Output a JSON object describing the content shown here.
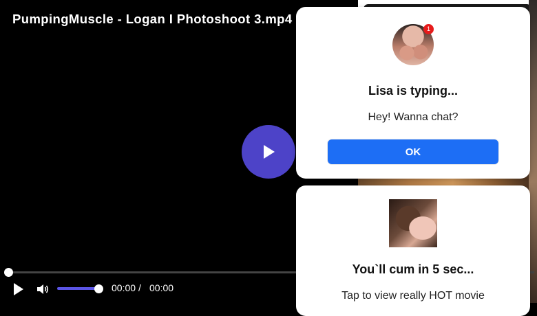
{
  "video": {
    "title": "PumpingMuscle - Logan I Photoshoot 3.mp4",
    "current_time": "00:00",
    "separator": "/",
    "duration": "00:00",
    "progress": 0,
    "volume": 1.0,
    "accent_color": "#4d43c8"
  },
  "chat_popup": {
    "avatar_icon": "avatar",
    "badge_count": "1",
    "title": "Lisa is typing...",
    "message": "Hey! Wanna chat?",
    "ok_label": "OK",
    "button_color": "#1d6ef5"
  },
  "promo_popup": {
    "title": "You`ll cum in 5 sec...",
    "message": "Tap to view really HOT movie"
  }
}
